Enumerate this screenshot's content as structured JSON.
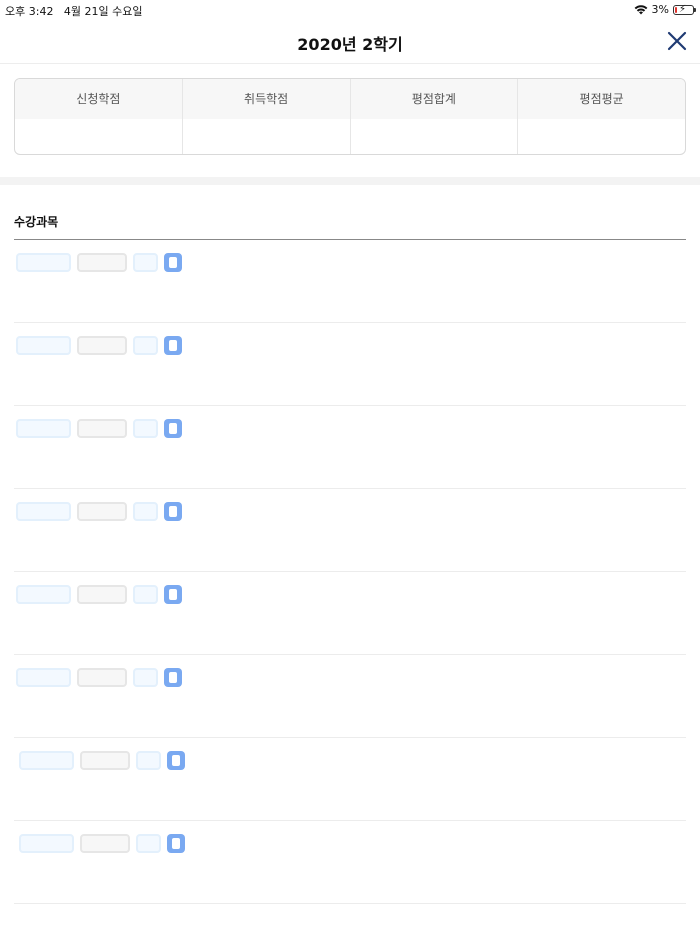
{
  "status_bar": {
    "time_date": "오후 3:42   4월 21일 수요일",
    "battery": "3%",
    "wifi_icon": "wifi-icon",
    "battery_icon": "battery-charging-icon"
  },
  "nav": {
    "title": "2020년 2학기",
    "close_icon": "close-icon",
    "accent_color": "#1f3b73"
  },
  "summary": {
    "columns": [
      {
        "label": "신청학점",
        "value": ""
      },
      {
        "label": "취득학점",
        "value": ""
      },
      {
        "label": "평점합계",
        "value": ""
      },
      {
        "label": "평점평균",
        "value": ""
      }
    ]
  },
  "courses_section": {
    "title": "수강과목",
    "row_count": 8
  },
  "colors": {
    "skeleton_blue": "#7aa9f1",
    "skeleton_light_blue": "#e3f0fc",
    "skeleton_gray": "#e6e6e6"
  }
}
